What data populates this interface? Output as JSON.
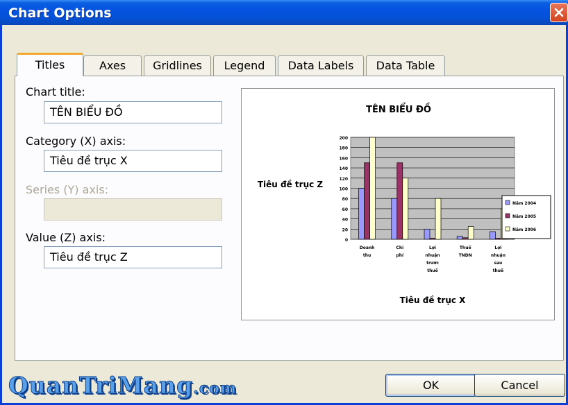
{
  "window": {
    "title": "Chart Options"
  },
  "tabs": [
    {
      "label": "Titles",
      "active": true
    },
    {
      "label": "Axes"
    },
    {
      "label": "Gridlines"
    },
    {
      "label": "Legend"
    },
    {
      "label": "Data Labels"
    },
    {
      "label": "Data Table"
    }
  ],
  "form": {
    "chart_title_label": "Chart title:",
    "chart_title_value": "TÊN BIỂU ĐỒ",
    "category_label": "Category (X) axis:",
    "category_value": "Tiêu đề trục X",
    "series_label": "Series (Y) axis:",
    "series_value": "",
    "value_label": "Value (Z) axis:",
    "value_value": "Tiêu đề trục Z"
  },
  "buttons": {
    "ok": "OK",
    "cancel": "Cancel"
  },
  "watermark": {
    "main": "QuanTriMang",
    "suffix": ".com"
  },
  "colors": {
    "accent": "#f1a82f",
    "titlebar": "#0553e0"
  },
  "chart_data": {
    "type": "bar",
    "title": "TÊN BIỂU ĐỒ",
    "xlabel": "Tiêu đề trục X",
    "ylabel": "Tiêu đề trục Z",
    "ylim": [
      0,
      200
    ],
    "yticks": [
      0,
      20,
      40,
      60,
      80,
      100,
      120,
      140,
      160,
      180,
      200
    ],
    "categories": [
      "Doanh thu",
      "Chi phí",
      "Lợi nhuận trước thuế",
      "Thuế TNDN",
      "Lợi nhuận sau thuế"
    ],
    "series": [
      {
        "name": "Năm 2004",
        "values": [
          100,
          80,
          20,
          6,
          15
        ],
        "color": "#9999ff"
      },
      {
        "name": "Năm 2005",
        "values": [
          150,
          150,
          2,
          3,
          2
        ],
        "color": "#993366"
      },
      {
        "name": "Năm 2006",
        "values": [
          200,
          120,
          80,
          25,
          60
        ],
        "color": "#ffffcc"
      }
    ],
    "legend_position": "right",
    "grid": true
  }
}
